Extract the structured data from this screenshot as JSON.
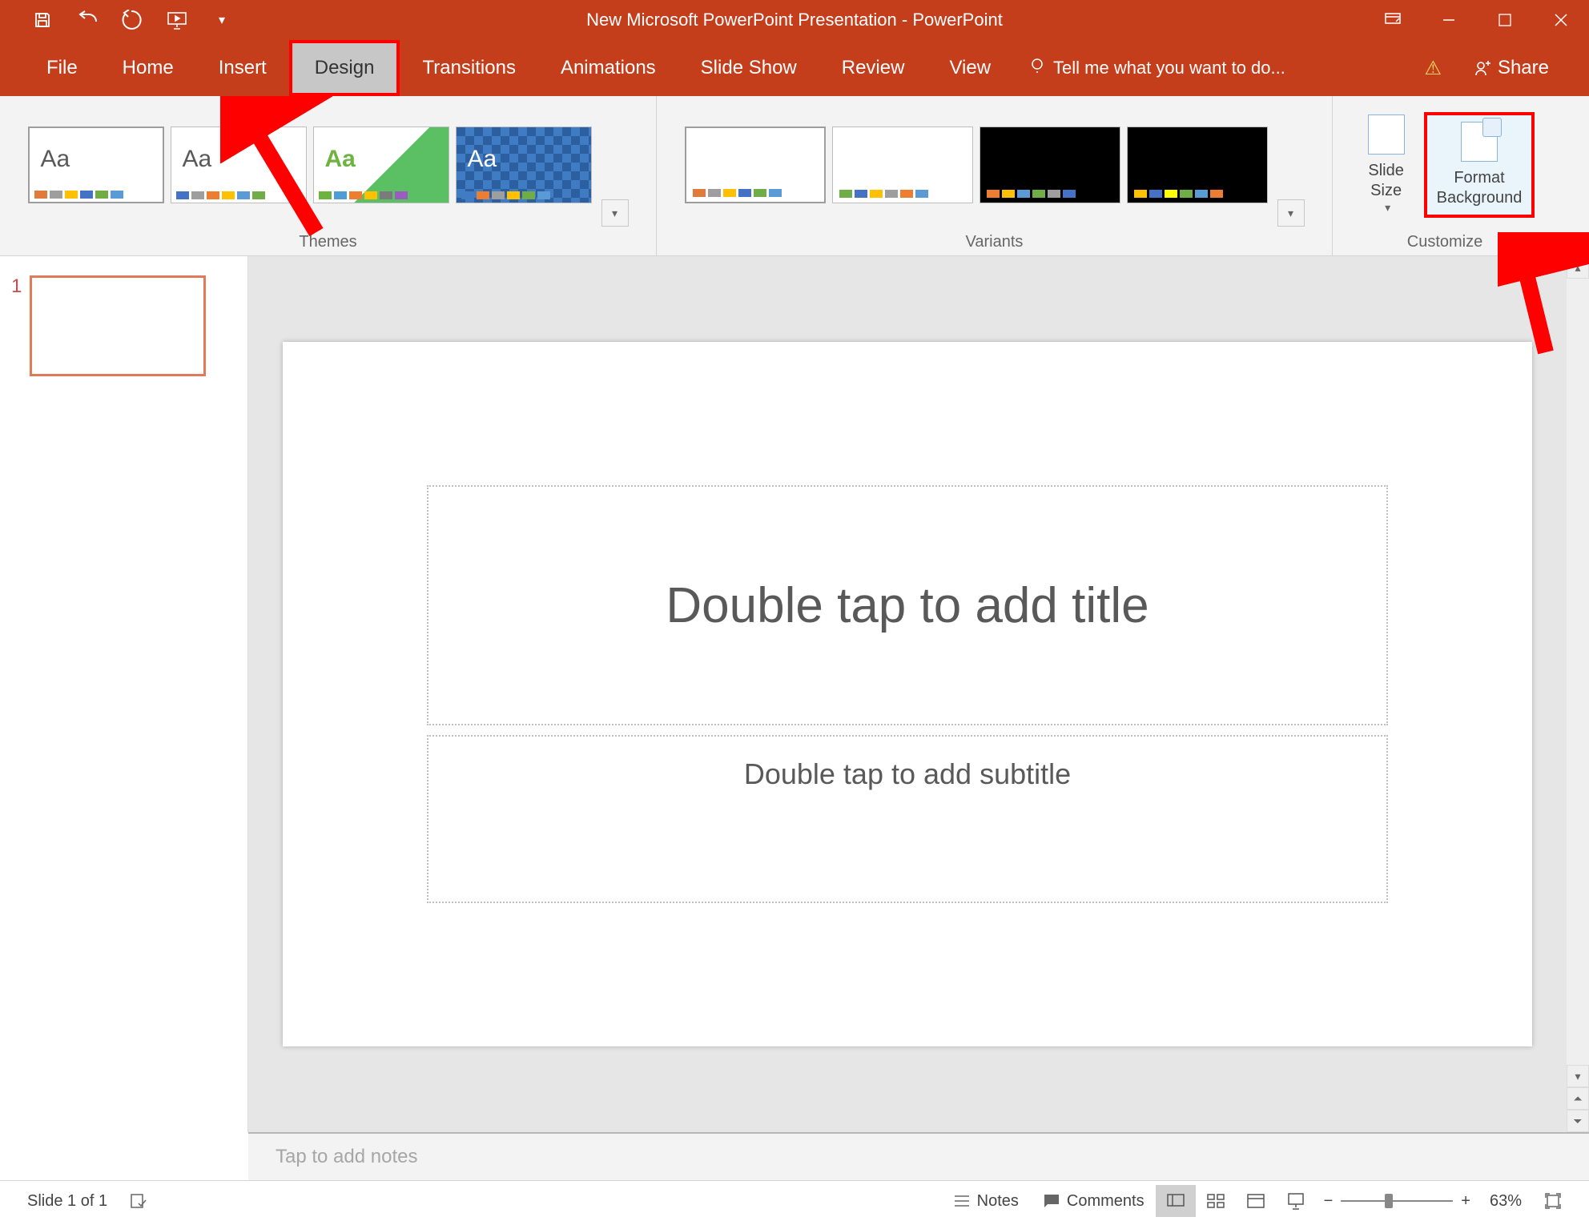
{
  "title": "New Microsoft PowerPoint Presentation - PowerPoint",
  "qat": {
    "save": "save-icon",
    "undo": "undo-icon",
    "redo": "redo-icon",
    "startshow": "start-slideshow-icon",
    "customize": "customize-qat-icon"
  },
  "win": {
    "displayopts": "ribbon-display-options",
    "min": "minimize",
    "restore": "restore",
    "close": "close"
  },
  "tabs": {
    "file": "File",
    "home": "Home",
    "insert": "Insert",
    "design": "Design",
    "transitions": "Transitions",
    "animations": "Animations",
    "slideshow": "Slide Show",
    "review": "Review",
    "view": "View"
  },
  "tellme": "Tell me what you want to do...",
  "share": "Share",
  "groups": {
    "themes": "Themes",
    "variants": "Variants",
    "customize": "Customize"
  },
  "custom": {
    "slidesize": "Slide\nSize",
    "formatbg": "Format\nBackground"
  },
  "slideNumber": "1",
  "placeholders": {
    "title": "Double tap to add title",
    "subtitle": "Double tap to add subtitle"
  },
  "notes": "Tap to add notes",
  "status": {
    "slideOf": "Slide 1 of 1",
    "notes": "Notes",
    "comments": "Comments",
    "zoomPct": "63%"
  },
  "themeThumbs": {
    "aa1": "Aa",
    "aa2": "Aa",
    "aa3": "Aa",
    "aa4": "Aa"
  },
  "colorSets": {
    "office": [
      "#4472c4",
      "#ed7d31",
      "#a5a5a5",
      "#ffc000",
      "#5b9bd5",
      "#70ad47"
    ],
    "variant2": [
      "#70ad47",
      "#5b9bd5",
      "#ffc000",
      "#a5a5a5",
      "#4472c4",
      "#ed7d31"
    ],
    "variant3": [
      "#ed7d31",
      "#ffc000",
      "#5b9bd5",
      "#70ad47",
      "#a5a5a5",
      "#4472c4"
    ],
    "variant4": [
      "#ffc000",
      "#4472c4",
      "#ffff00",
      "#70ad47",
      "#5b9bd5",
      "#ed7d31"
    ]
  }
}
